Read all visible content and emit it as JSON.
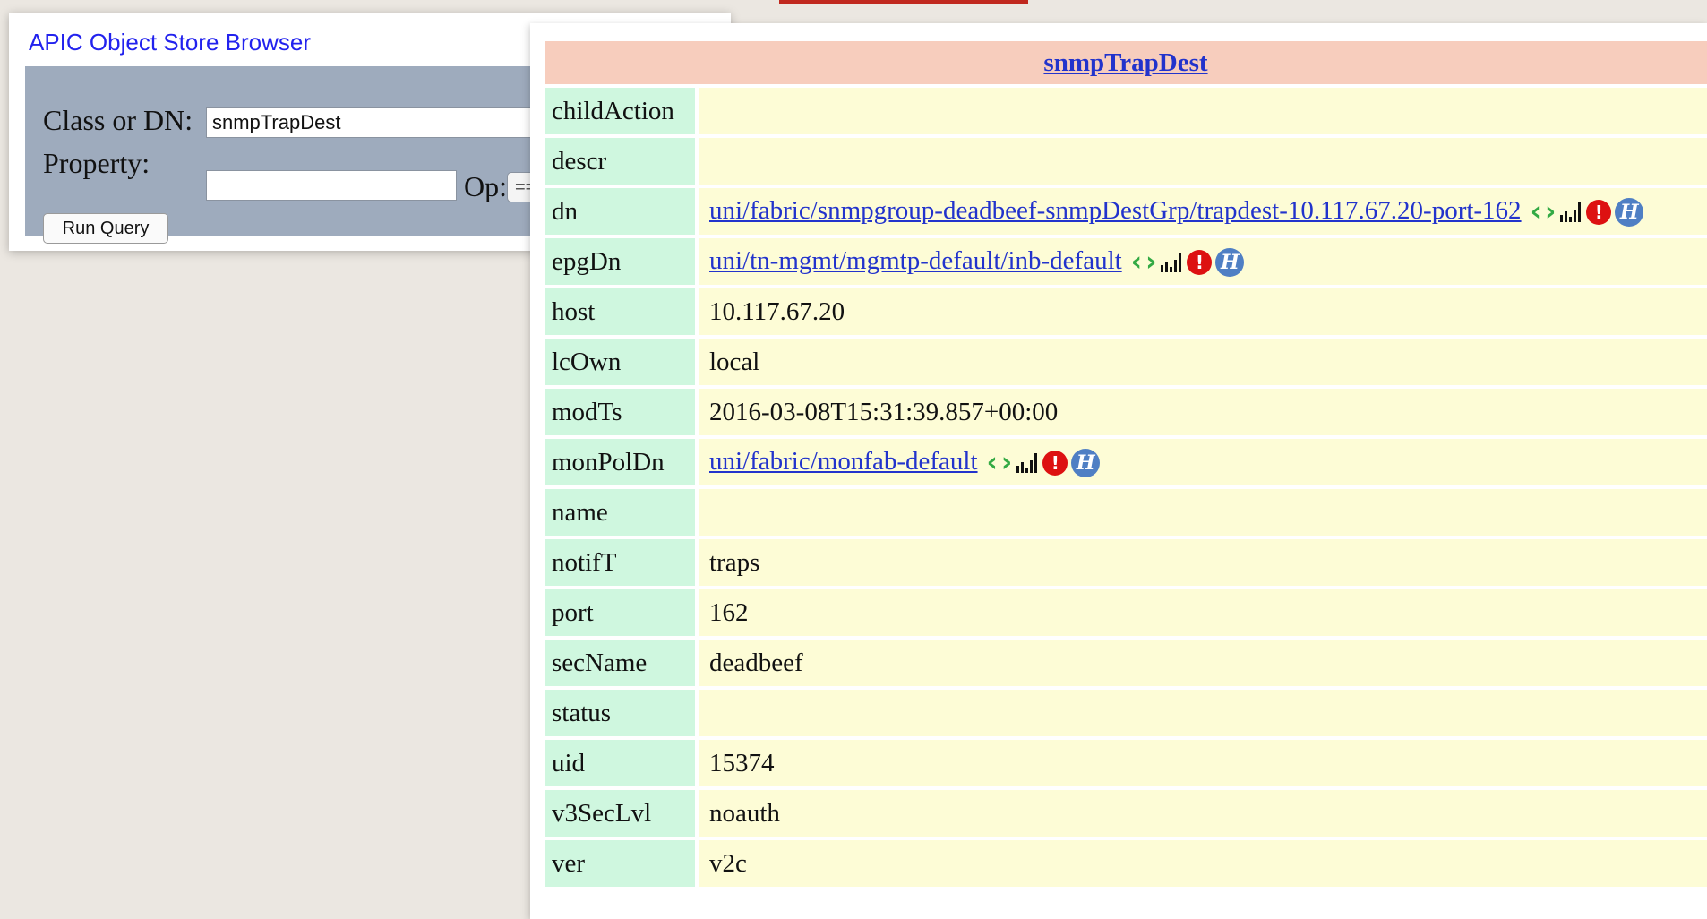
{
  "browser": {
    "title": "APIC Object Store Browser",
    "class_label": "Class or DN:",
    "class_value": "snmpTrapDest",
    "property_label": "Property:",
    "property_value": "",
    "op_label": "Op:",
    "op_value": "==",
    "run_button": "Run Query"
  },
  "result": {
    "class_name": "snmpTrapDest",
    "rows": [
      {
        "prop": "childAction",
        "value": "",
        "link": false
      },
      {
        "prop": "descr",
        "value": "",
        "link": false
      },
      {
        "prop": "dn",
        "value": "uni/fabric/snmpgroup-deadbeef-snmpDestGrp/trapdest-10.117.67.20-port-162",
        "link": true
      },
      {
        "prop": "epgDn",
        "value": "uni/tn-mgmt/mgmtp-default/inb-default",
        "link": true
      },
      {
        "prop": "host",
        "value": "10.117.67.20",
        "link": false
      },
      {
        "prop": "lcOwn",
        "value": "local",
        "link": false
      },
      {
        "prop": "modTs",
        "value": "2016-03-08T15:31:39.857+00:00",
        "link": false
      },
      {
        "prop": "monPolDn",
        "value": "uni/fabric/monfab-default",
        "link": true
      },
      {
        "prop": "name",
        "value": "",
        "link": false
      },
      {
        "prop": "notifT",
        "value": "traps",
        "link": false
      },
      {
        "prop": "port",
        "value": "162",
        "link": false
      },
      {
        "prop": "secName",
        "value": "deadbeef",
        "link": false
      },
      {
        "prop": "status",
        "value": "",
        "link": false
      },
      {
        "prop": "uid",
        "value": "15374",
        "link": false
      },
      {
        "prop": "v3SecLvl",
        "value": "noauth",
        "link": false
      },
      {
        "prop": "ver",
        "value": "v2c",
        "link": false
      }
    ]
  },
  "icons": {
    "prev": "chevron-left-icon",
    "next": "chevron-right-icon",
    "stats": "stats-bars-icon",
    "faults": "fault-icon",
    "history": "history-icon"
  },
  "colors": {
    "header_bg": "#f7cdbd",
    "prop_bg": "#cff7df",
    "value_bg": "#fdfcd6",
    "form_bg": "#9eabbd",
    "link": "#2233cc"
  }
}
